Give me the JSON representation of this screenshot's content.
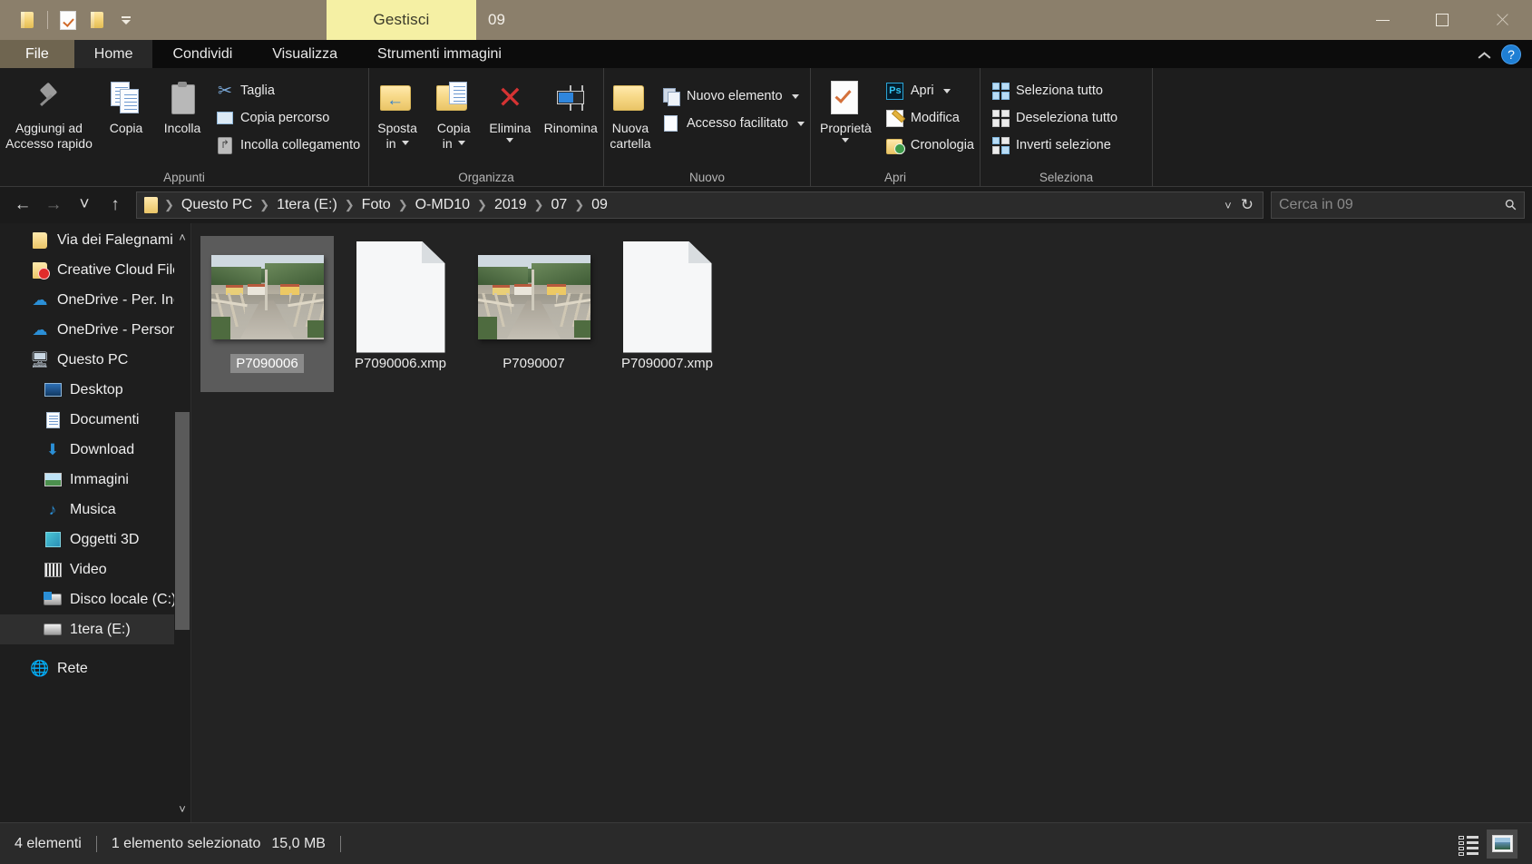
{
  "titlebar": {
    "quick_access": [
      {
        "name": "folder-icon",
        "label": "Cartella"
      },
      {
        "name": "properties-check-icon",
        "label": "Proprietà"
      },
      {
        "name": "new-folder-icon",
        "label": "Nuova cartella"
      },
      {
        "name": "customize-qat-icon",
        "label": "Personalizza barra di accesso rapido"
      }
    ],
    "contextual_tab": "Gestisci",
    "window_title": "09",
    "minimize": "—",
    "maximize": "□",
    "close": "✕"
  },
  "ribbon_tabs": {
    "file": "File",
    "items": [
      "Home",
      "Condividi",
      "Visualizza",
      "Strumenti immagini"
    ],
    "active": "Home",
    "collapse": "^",
    "help": "?"
  },
  "ribbon": {
    "groups": [
      {
        "label": "Appunti",
        "big_buttons": [
          {
            "name": "pin-to-quick-access",
            "line1": "Aggiungi ad",
            "line2": "Accesso rapido",
            "icon": "pin-icon"
          },
          {
            "name": "copy",
            "line1": "Copia",
            "line2": "",
            "icon": "copy-icon"
          },
          {
            "name": "paste",
            "line1": "Incolla",
            "line2": "",
            "icon": "clipboard-icon"
          }
        ],
        "small_buttons": [
          {
            "name": "cut",
            "label": "Taglia",
            "icon": "scissors-icon"
          },
          {
            "name": "copy-path",
            "label": "Copia percorso",
            "icon": "path-icon"
          },
          {
            "name": "paste-shortcut",
            "label": "Incolla collegamento",
            "icon": "paste-link-icon"
          }
        ]
      },
      {
        "label": "Organizza",
        "big_buttons": [
          {
            "name": "move-to",
            "line1": "Sposta",
            "line2": "in",
            "icon": "folder-arrow-icon",
            "caret": true
          },
          {
            "name": "copy-to",
            "line1": "Copia",
            "line2": "in",
            "icon": "folder-copy-icon",
            "caret": true
          },
          {
            "name": "delete",
            "line1": "Elimina",
            "line2": "",
            "icon": "delete-x-icon",
            "caret": true
          },
          {
            "name": "rename",
            "line1": "Rinomina",
            "line2": "",
            "icon": "rename-icon",
            "caret": false
          }
        ],
        "small_buttons": []
      },
      {
        "label": "Nuovo",
        "big_buttons": [
          {
            "name": "new-folder",
            "line1": "Nuova",
            "line2": "cartella",
            "icon": "new-folder-icon"
          }
        ],
        "small_buttons": [
          {
            "name": "new-item",
            "label": "Nuovo elemento",
            "icon": "new-item-icon",
            "caret": true
          },
          {
            "name": "easy-access",
            "label": "Accesso facilitato",
            "icon": "easy-access-icon",
            "caret": true
          }
        ]
      },
      {
        "label": "Apri",
        "big_buttons": [
          {
            "name": "properties",
            "line1": "Proprietà",
            "line2": "",
            "icon": "properties-icon",
            "caret": true
          }
        ],
        "small_buttons": [
          {
            "name": "open-with",
            "label": "Apri",
            "icon": "photoshop-icon",
            "caret": true
          },
          {
            "name": "edit",
            "label": "Modifica",
            "icon": "edit-icon"
          },
          {
            "name": "history",
            "label": "Cronologia",
            "icon": "history-icon"
          }
        ]
      },
      {
        "label": "Seleziona",
        "big_buttons": [],
        "small_buttons": [
          {
            "name": "select-all",
            "label": "Seleziona tutto",
            "icon": "select-all-icon"
          },
          {
            "name": "select-none",
            "label": "Deseleziona tutto",
            "icon": "select-none-icon"
          },
          {
            "name": "invert-selection",
            "label": "Inverti selezione",
            "icon": "invert-selection-icon"
          }
        ]
      }
    ]
  },
  "addressbar": {
    "back": "←",
    "forward": "→",
    "recent": "˅",
    "up": "↑",
    "breadcrumbs": [
      "Questo PC",
      "1tera (E:)",
      "Foto",
      "O-MD10",
      "2019",
      "07",
      "09"
    ],
    "dropdown": "˅",
    "refresh": "↻",
    "search_placeholder": "Cerca in 09",
    "search_value": ""
  },
  "navpane": {
    "scroll_up": "˄",
    "scroll_down": "˅",
    "items": [
      {
        "label": "Via dei Falegnami",
        "icon": "folder-icon",
        "level": 1,
        "selected": false
      },
      {
        "label": "Creative Cloud Files",
        "icon": "creative-cloud-icon",
        "level": 1,
        "selected": false
      },
      {
        "label": "OneDrive - Per. Ind",
        "icon": "onedrive-icon",
        "level": 1,
        "selected": false
      },
      {
        "label": "OneDrive - Personal",
        "icon": "onedrive-icon",
        "level": 1,
        "selected": false
      },
      {
        "label": "Questo PC",
        "icon": "this-pc-icon",
        "level": 1,
        "selected": false
      },
      {
        "label": "Desktop",
        "icon": "desktop-icon",
        "level": 2,
        "selected": false
      },
      {
        "label": "Documenti",
        "icon": "documents-icon",
        "level": 2,
        "selected": false
      },
      {
        "label": "Download",
        "icon": "downloads-icon",
        "level": 2,
        "selected": false
      },
      {
        "label": "Immagini",
        "icon": "pictures-icon",
        "level": 2,
        "selected": false
      },
      {
        "label": "Musica",
        "icon": "music-icon",
        "level": 2,
        "selected": false
      },
      {
        "label": "Oggetti 3D",
        "icon": "3d-objects-icon",
        "level": 2,
        "selected": false
      },
      {
        "label": "Video",
        "icon": "videos-icon",
        "level": 2,
        "selected": false
      },
      {
        "label": "Disco locale (C:)",
        "icon": "windows-drive-icon",
        "level": 2,
        "selected": false
      },
      {
        "label": "1tera (E:)",
        "icon": "drive-icon",
        "level": 2,
        "selected": true
      },
      {
        "label": "Rete",
        "icon": "network-icon",
        "level": 1,
        "selected": false
      }
    ]
  },
  "files": [
    {
      "name": "P7090006",
      "type": "photo",
      "selected": true
    },
    {
      "name": "P7090006.xmp",
      "type": "xmp",
      "selected": false
    },
    {
      "name": "P7090007",
      "type": "photo",
      "selected": false
    },
    {
      "name": "P7090007.xmp",
      "type": "xmp",
      "selected": false
    }
  ],
  "statusbar": {
    "item_count": "4 elementi",
    "selection_info": "1 elemento selezionato",
    "selection_size": "15,0 MB",
    "view_details": "Dettagli",
    "view_large_icons": "Icone grandi"
  },
  "colors": {
    "titlebar": "#8b7f6b",
    "contextual_tab": "#f5f0a4",
    "file_tab": "#6f6550",
    "accent": "#2f86dd",
    "selection": "#5b5b5b"
  }
}
